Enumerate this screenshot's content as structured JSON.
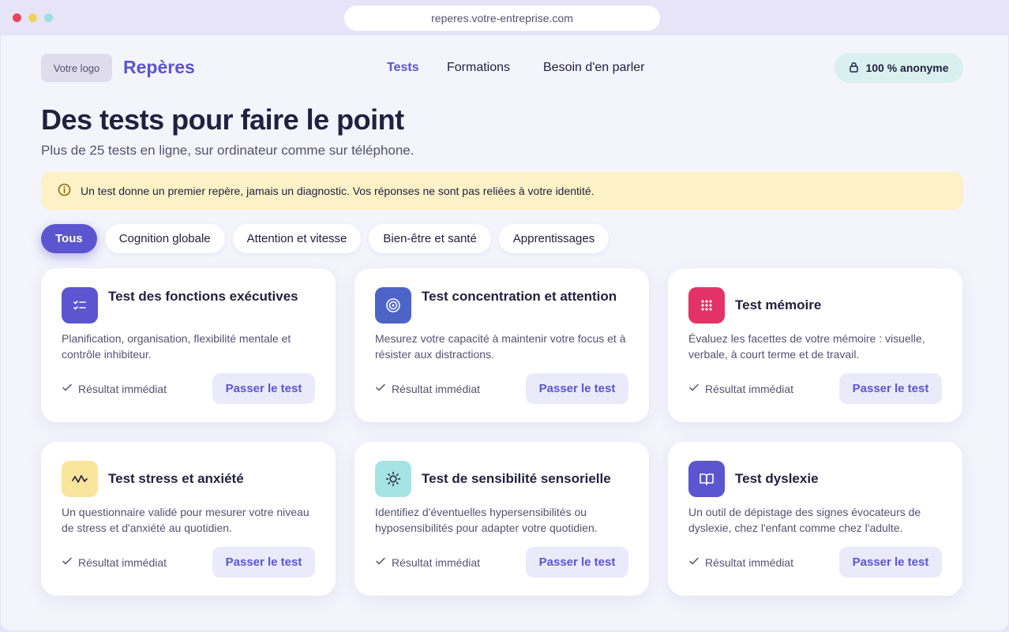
{
  "browser": {
    "url": "reperes.votre-entreprise.com"
  },
  "header": {
    "logo_placeholder": "Votre logo",
    "brand": "Repères",
    "nav": [
      {
        "label": "Tests",
        "active": true
      },
      {
        "label": "Formations",
        "active": false
      },
      {
        "label": "Besoin d'en parler",
        "active": false
      }
    ],
    "anon_badge": {
      "icon": "lock-icon",
      "label": "100 % anonyme"
    }
  },
  "main": {
    "title": "Des tests pour faire le point",
    "subtitle": "Plus de 25 tests en ligne, sur ordinateur comme sur téléphone.",
    "notice": {
      "icon": "info-icon",
      "text": "Un test donne un premier repère, jamais un diagnostic. Vos réponses ne sont pas reliées à votre identité."
    },
    "filters": [
      {
        "label": "Tous",
        "active": true
      },
      {
        "label": "Cognition globale",
        "active": false
      },
      {
        "label": "Attention et vitesse",
        "active": false
      },
      {
        "label": "Bien-être et santé",
        "active": false
      },
      {
        "label": "Apprentissages",
        "active": false
      }
    ],
    "cards": [
      {
        "icon": "checklist-icon",
        "icon_bg": "#5b55cf",
        "title": "Test des fonctions exécutives",
        "description": "Planification, organisation, flexibilité mentale et contrôle inhibiteur.",
        "result": "Résultat immédiat",
        "button": "Passer le test"
      },
      {
        "icon": "target-icon",
        "icon_bg": "#4d63c6",
        "title": "Test concentration et attention",
        "description": "Mesurez votre capacité à maintenir votre focus et à résister aux distractions.",
        "result": "Résultat immédiat",
        "button": "Passer le test"
      },
      {
        "icon": "grid-dots-icon",
        "icon_bg": "#e33366",
        "title": "Test mémoire",
        "description": "Évaluez les facettes de votre mémoire : visuelle, verbale, à court terme et de travail.",
        "result": "Résultat immédiat",
        "button": "Passer le test"
      },
      {
        "icon": "wave-icon",
        "icon_bg": "#fbe59c",
        "title": "Test stress et anxiété",
        "description": "Un questionnaire validé pour mesurer votre niveau de stress et d'anxiété au quotidien.",
        "result": "Résultat immédiat",
        "button": "Passer le test"
      },
      {
        "icon": "sun-icon",
        "icon_bg": "#a6e3e4",
        "title": "Test de sensibilité sensorielle",
        "description": "Identifiez d'éventuelles hypersensibilités ou hyposensibilités pour adapter votre quotidien.",
        "result": "Résultat immédiat",
        "button": "Passer le test"
      },
      {
        "icon": "book-icon",
        "icon_bg": "#5b55cf",
        "title": "Test dyslexie",
        "description": "Un outil de dépistage des signes évocateurs de dyslexie, chez l'enfant comme chez l'adulte.",
        "result": "Résultat immédiat",
        "button": "Passer le test"
      }
    ]
  }
}
